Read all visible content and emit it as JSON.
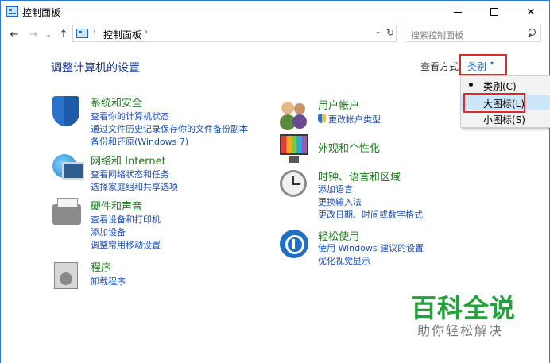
{
  "window": {
    "title": "控制面板"
  },
  "address": {
    "breadcrumb_sep": "›",
    "location": "控制面板",
    "location_sep": "›",
    "dropdown_glyph": "⌄",
    "refresh_glyph": "↻"
  },
  "nav": {
    "back_glyph": "←",
    "forward_glyph": "→",
    "recent_glyph": "⌄",
    "up_glyph": "↑"
  },
  "search": {
    "placeholder": "搜索控制面板"
  },
  "header": {
    "title": "调整计算机的设置",
    "view_by_label": "查看方式:",
    "view_by_value": "类别",
    "view_by_caret": "▾"
  },
  "view_menu": {
    "items": [
      {
        "label": "类别(C)",
        "selected": true
      },
      {
        "label": "大图标(L)",
        "hovered": true
      },
      {
        "label": "小图标(S)"
      }
    ]
  },
  "categories": {
    "security": {
      "title": "系统和安全",
      "links": [
        "查看你的计算机状态",
        "通过文件历史记录保存你的文件备份副本",
        "备份和还原(Windows 7)"
      ]
    },
    "network": {
      "title": "网络和 Internet",
      "links": [
        "查看网络状态和任务",
        "选择家庭组和共享选项"
      ]
    },
    "hardware": {
      "title": "硬件和声音",
      "links": [
        "查看设备和打印机",
        "添加设备",
        "调整常用移动设置"
      ]
    },
    "programs": {
      "title": "程序",
      "links": [
        "卸载程序"
      ]
    },
    "users": {
      "title": "用户帐户",
      "links": [
        "更改帐户类型"
      ]
    },
    "appearance": {
      "title": "外观和个性化",
      "links": []
    },
    "clock": {
      "title": "时钟、语言和区域",
      "links": [
        "添加语言",
        "更换输入法",
        "更改日期、时间或数字格式"
      ]
    },
    "ease": {
      "title": "轻松使用",
      "links": [
        "使用 Windows 建议的设置",
        "优化视觉显示"
      ]
    }
  },
  "watermark": {
    "title": "百科全说",
    "subtitle": "助你轻松解决"
  },
  "colors": {
    "accent": "#1a6fd0",
    "link": "#1a4fb5",
    "category_title": "#1e7a1e",
    "heading": "#1a3a8a",
    "highlight_box": "#e02a2a",
    "watermark": "#22a33a"
  }
}
